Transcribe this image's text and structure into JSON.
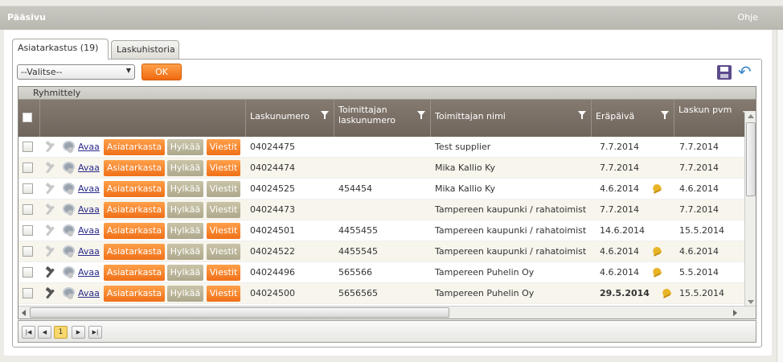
{
  "window": {
    "title": "Pääsivu",
    "help": "Ohje"
  },
  "tabs": [
    {
      "label": "Asiatarkastus (19)"
    },
    {
      "label": "Laskuhistoria"
    }
  ],
  "toolbar": {
    "select_value": "--Valitse--",
    "ok_label": "OK"
  },
  "grid": {
    "group_label": "Ryhmittely",
    "columns": [
      {
        "label": "Laskunumero"
      },
      {
        "label": "Toimittajan laskunumero"
      },
      {
        "label": "Toimittajan nimi"
      },
      {
        "label": "Eräpäivä"
      },
      {
        "label": "Laskun pvm"
      }
    ],
    "action_labels": {
      "open": "Avaa",
      "review": "Asiatarkasta",
      "reject": "Hylkää",
      "messages": "Viestit"
    },
    "rows": [
      {
        "invoice": "04024475",
        "supplier_invoice": "",
        "supplier": "Test supplier",
        "due": "7.7.2014",
        "date": "7.7.2014",
        "bell": false,
        "reject_grey": true,
        "msg_grey": false,
        "dark_hammer": false,
        "due_bold": false
      },
      {
        "invoice": "04024474",
        "supplier_invoice": "",
        "supplier": "Mika Kallio Ky",
        "due": "7.7.2014",
        "date": "7.7.2014",
        "bell": false,
        "reject_grey": true,
        "msg_grey": false,
        "dark_hammer": false,
        "due_bold": false
      },
      {
        "invoice": "04024525",
        "supplier_invoice": "454454",
        "supplier": "Mika Kallio Ky",
        "due": "4.6.2014",
        "date": "4.6.2014",
        "bell": true,
        "reject_grey": true,
        "msg_grey": true,
        "dark_hammer": false,
        "due_bold": false
      },
      {
        "invoice": "04024473",
        "supplier_invoice": "",
        "supplier": "Tampereen kaupunki / rahatoimist",
        "due": "7.7.2014",
        "date": "7.7.2014",
        "bell": false,
        "reject_grey": true,
        "msg_grey": true,
        "dark_hammer": false,
        "due_bold": false
      },
      {
        "invoice": "04024501",
        "supplier_invoice": "4455455",
        "supplier": "Tampereen kaupunki / rahatoimist",
        "due": "14.6.2014",
        "date": "15.5.2014",
        "bell": false,
        "reject_grey": true,
        "msg_grey": false,
        "dark_hammer": false,
        "due_bold": false
      },
      {
        "invoice": "04024522",
        "supplier_invoice": "4455545",
        "supplier": "Tampereen kaupunki / rahatoimist",
        "due": "4.6.2014",
        "date": "4.6.2014",
        "bell": true,
        "reject_grey": true,
        "msg_grey": true,
        "dark_hammer": false,
        "due_bold": false
      },
      {
        "invoice": "04024496",
        "supplier_invoice": "565566",
        "supplier": "Tampereen Puhelin Oy",
        "due": "4.6.2014",
        "date": "5.5.2014",
        "bell": true,
        "reject_grey": true,
        "msg_grey": false,
        "dark_hammer": true,
        "due_bold": false
      },
      {
        "invoice": "04024500",
        "supplier_invoice": "5656565",
        "supplier": "Tampereen Puhelin Oy",
        "due": "29.5.2014",
        "date": "15.5.2014",
        "bell": true,
        "reject_grey": true,
        "msg_grey": false,
        "dark_hammer": true,
        "due_bold": true
      }
    ]
  },
  "pager": {
    "current_page": "1"
  },
  "icons": {
    "save": "save-icon",
    "undo": "undo-icon",
    "filter": "filter-icon",
    "bell": "bell-icon",
    "hammer": "hammer-icon",
    "gear": "gear-icon"
  }
}
